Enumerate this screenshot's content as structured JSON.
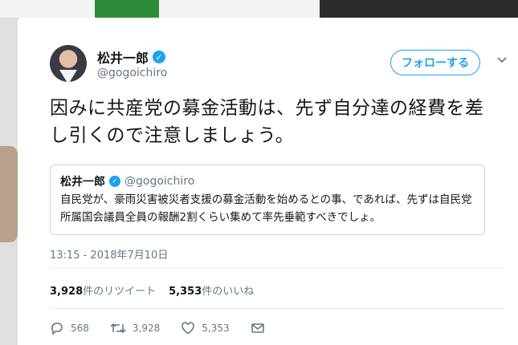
{
  "tweet": {
    "author_name": "松井一郎",
    "author_handle": "@gogoichiro",
    "follow_label": "フォローする",
    "text": "因みに共産党の募金活動は、先ず自分達の経費を差し引くので注意しましょう。",
    "timestamp": "13:15 - 2018年7月10日"
  },
  "quote": {
    "author_name": "松井一郎",
    "author_handle": "@gogoichiro",
    "text": "自民党が、豪雨災害被災者支援の募金活動を始めるとの事、であれば、先ずは自民党所属国会議員全員の報酬2割くらい集めて率先垂範すべきでしょ。"
  },
  "stats": {
    "retweets_count": "3,928",
    "retweets_label": "件のリツイート",
    "likes_count": "5,353",
    "likes_label": "件のいいね"
  },
  "actions": {
    "replies": "568",
    "retweets": "3,928",
    "likes": "5,353"
  },
  "colors": {
    "accent": "#1da1f2",
    "text": "#14171a",
    "muted": "#657786"
  },
  "icons": [
    "verified-icon",
    "chevron-down-icon",
    "reply-icon",
    "retweet-icon",
    "heart-icon",
    "mail-icon"
  ]
}
